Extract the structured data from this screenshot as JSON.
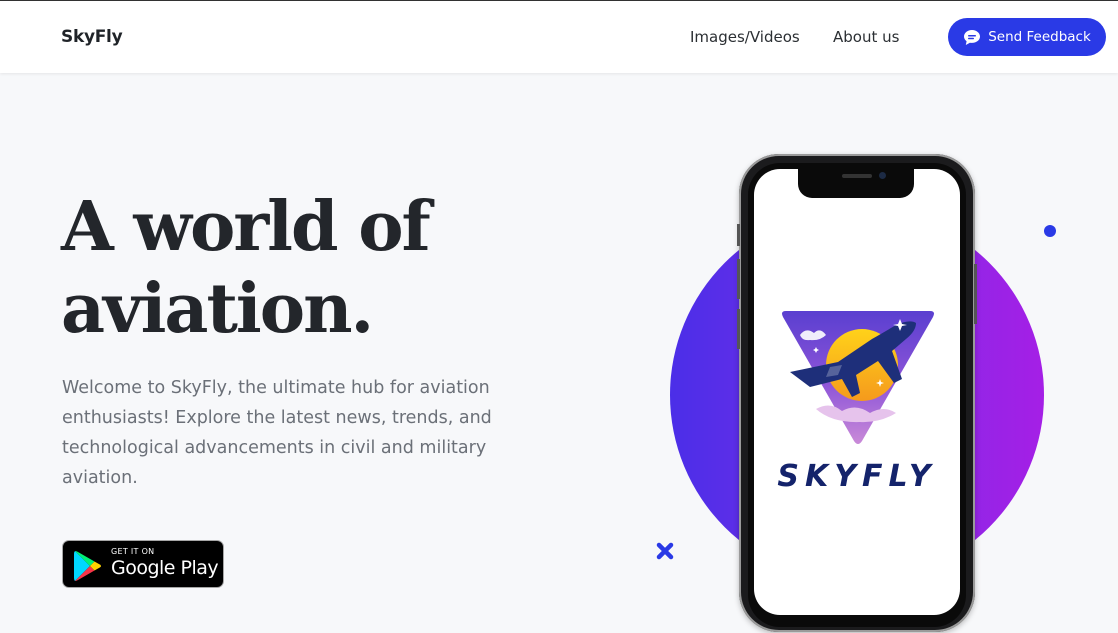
{
  "navbar": {
    "brand": "SkyFly",
    "links": [
      {
        "label": "Images/Videos"
      },
      {
        "label": "About us"
      }
    ],
    "feedback_button": {
      "label": "Send Feedback",
      "icon": "chat-bubble-icon"
    }
  },
  "hero": {
    "title_line1": "A world of",
    "title_line2": "aviation.",
    "description": "Welcome to SkyFly, the ultimate hub for aviation enthusiasts! Explore the latest news, trends, and technological advancements in civil and military aviation.",
    "store_badge": {
      "small_text": "GET IT ON",
      "large_text": "Google Play",
      "icon": "google-play-icon"
    }
  },
  "phone": {
    "app_logo_text": "SKYFLY"
  },
  "colors": {
    "accent": "#2a3ae6",
    "circle_start": "#4b2ee8",
    "circle_end": "#a51fe6",
    "title_text": "#23262b",
    "body_text": "#6b7078",
    "background": "#f7f8fa"
  }
}
